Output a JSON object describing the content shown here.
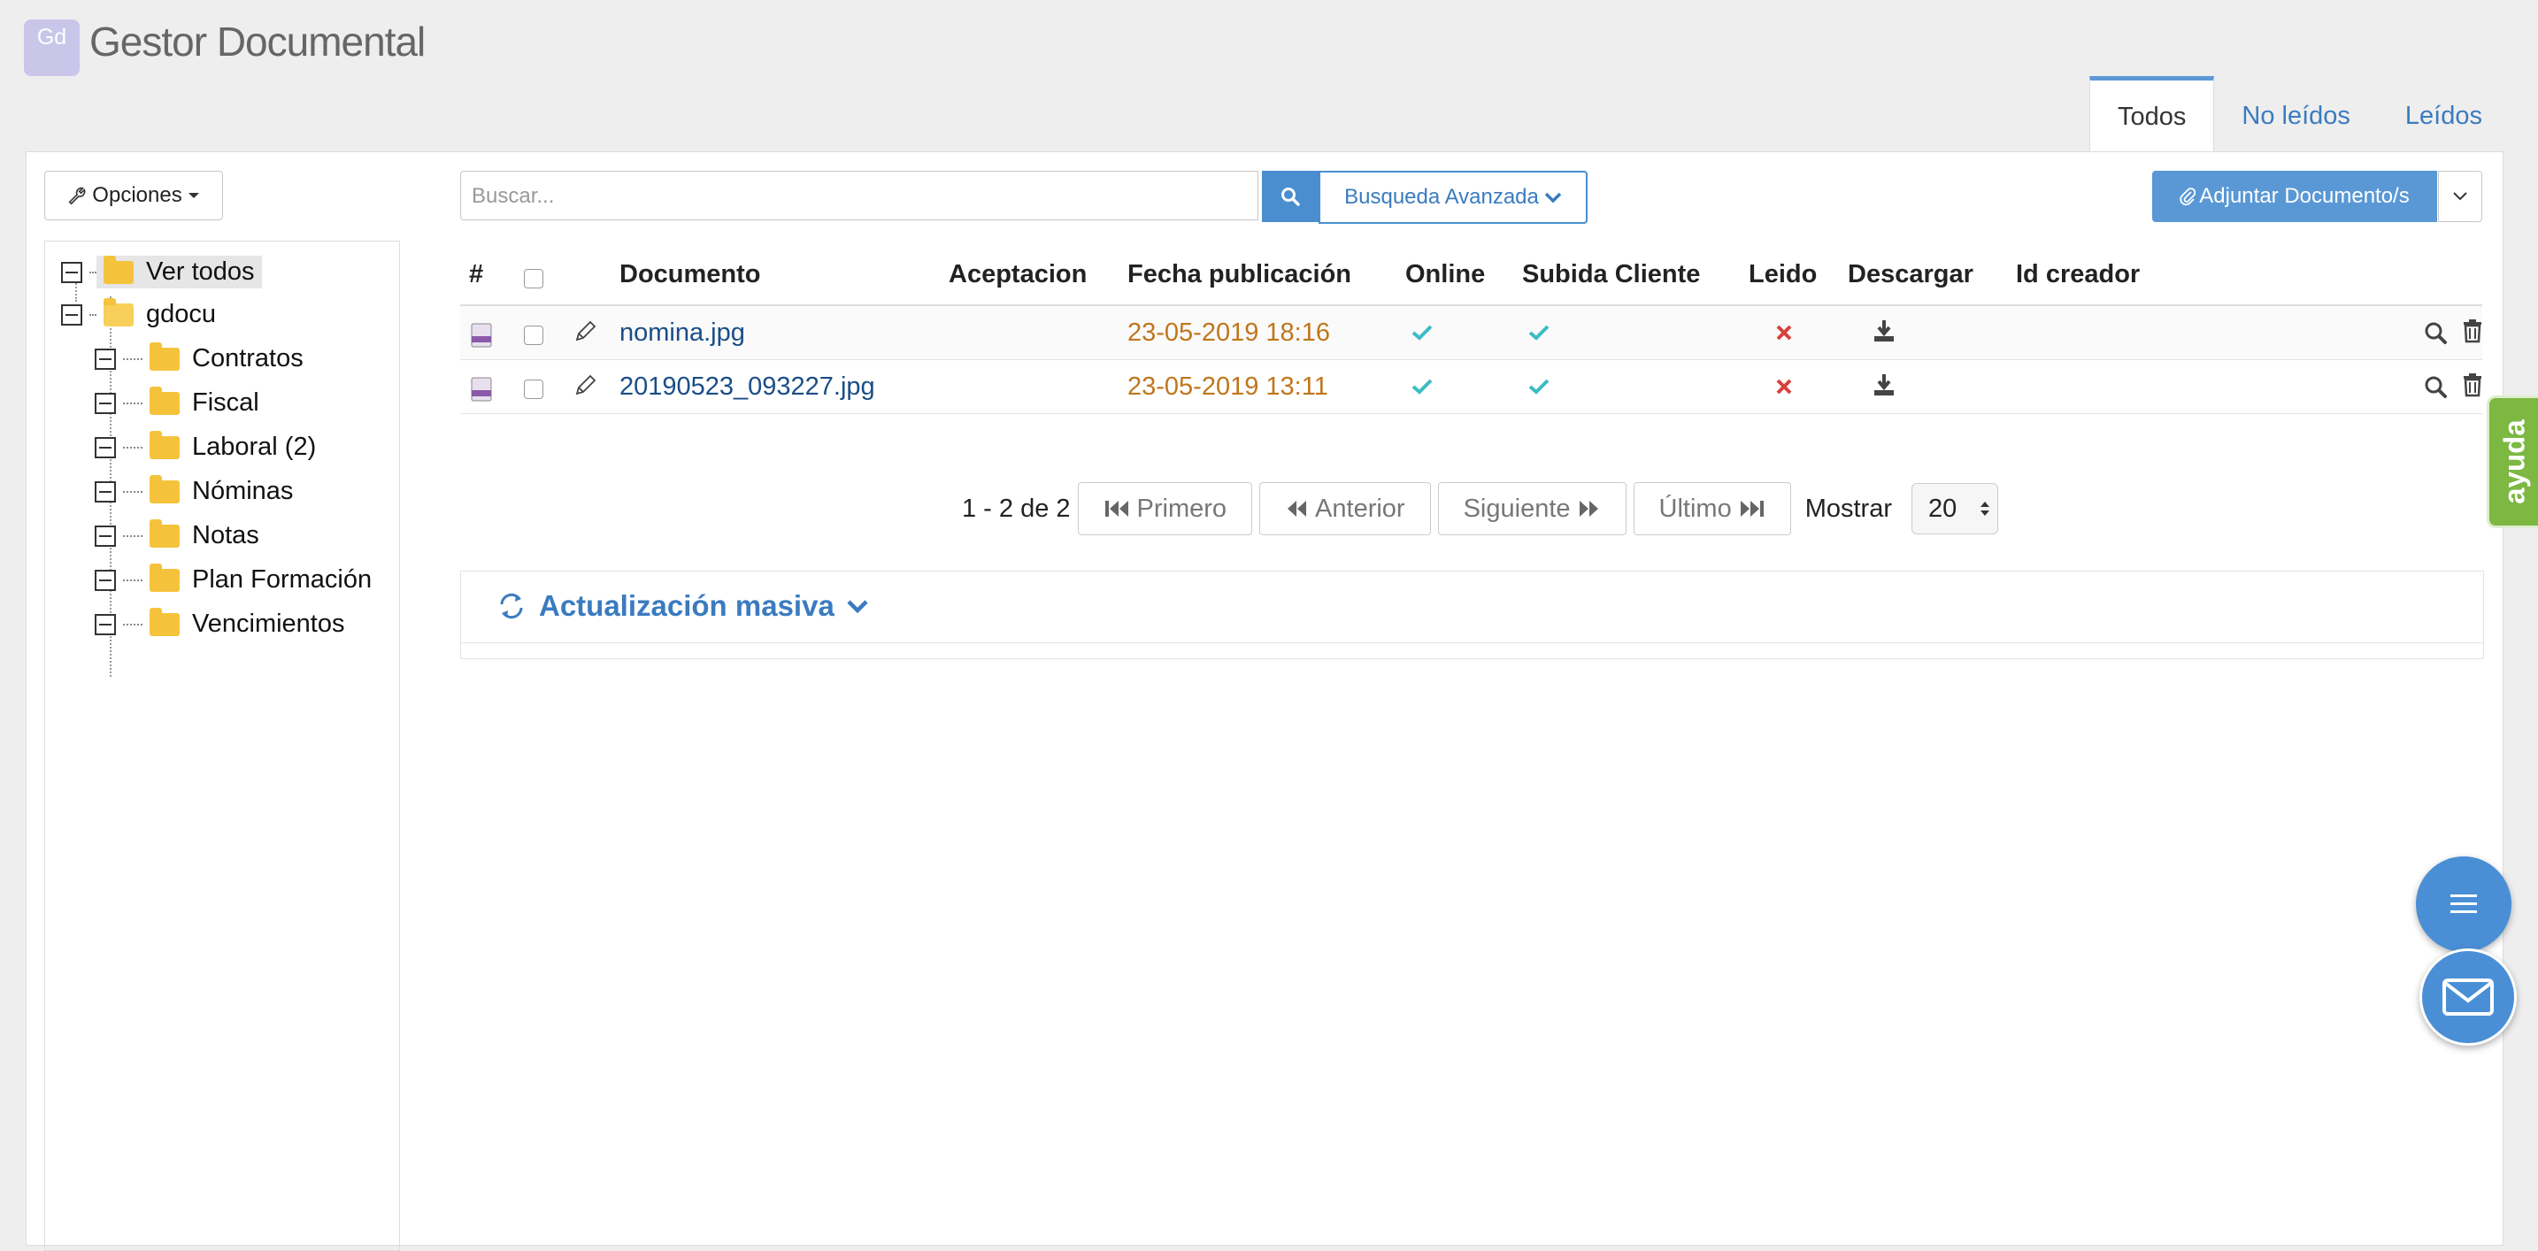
{
  "app": {
    "logo_text": "Gd",
    "title": "Gestor Documental"
  },
  "tabs": [
    {
      "label": "Todos",
      "active": true
    },
    {
      "label": "No leídos",
      "active": false
    },
    {
      "label": "Leídos",
      "active": false
    }
  ],
  "toolbar": {
    "options_label": "Opciones",
    "search_placeholder": "Buscar...",
    "advanced_search_label": "Busqueda Avanzada",
    "attach_label": "Adjuntar Documento/s"
  },
  "tree": {
    "root_label": "Ver todos",
    "folder_label": "gdocu",
    "children": [
      "Contratos",
      "Fiscal",
      "Laboral (2)",
      "Nóminas",
      "Notas",
      "Plan Formación",
      "Vencimientos"
    ]
  },
  "table": {
    "headers": {
      "num": "#",
      "documento": "Documento",
      "aceptacion": "Aceptacion",
      "fecha": "Fecha publicación",
      "online": "Online",
      "subida": "Subida Cliente",
      "leido": "Leido",
      "descargar": "Descargar",
      "creador": "Id creador"
    },
    "rows": [
      {
        "document": "nomina.jpg",
        "date": "23-05-2019 18:16",
        "online": true,
        "subida": true,
        "leido": false
      },
      {
        "document": "20190523_093227.jpg",
        "date": "23-05-2019 13:11",
        "online": true,
        "subida": true,
        "leido": false
      }
    ]
  },
  "pagination": {
    "range": "1 - 2 de 2",
    "first": "Primero",
    "prev": "Anterior",
    "next": "Siguiente",
    "last": "Último",
    "show_label": "Mostrar",
    "page_size": "20"
  },
  "bulk_update": {
    "label": "Actualización masiva"
  },
  "help_tab": {
    "label": "ayuda"
  },
  "colors": {
    "accent": "#4a8ed0",
    "date": "#c0761c",
    "check": "#3cbcc4",
    "cross": "#d9413b",
    "folder": "#f5c33b",
    "help": "#7cb842"
  }
}
